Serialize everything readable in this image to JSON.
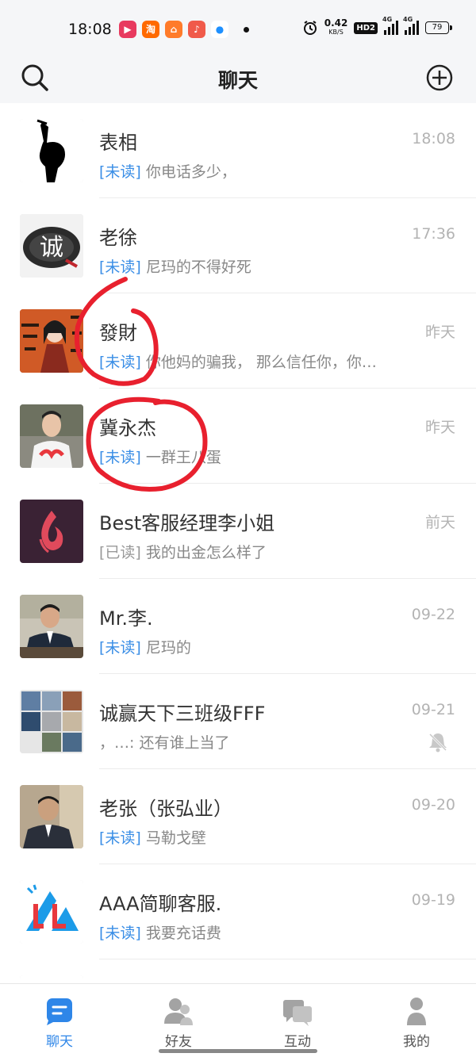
{
  "status_bar": {
    "time": "18:08",
    "app_icons": [
      {
        "icon": "video-app-icon",
        "glyph": "▶",
        "color": "#e83a5f"
      },
      {
        "icon": "taobao-app-icon",
        "glyph": "淘",
        "color": "#ff6a00"
      },
      {
        "icon": "orange-app-icon",
        "glyph": "⌂",
        "color": "#ff7b2a"
      },
      {
        "icon": "music-app-icon",
        "glyph": "♪",
        "color": "#f05a4a"
      },
      {
        "icon": "circle-app-icon",
        "glyph": "●",
        "color": "#1e90ff"
      }
    ],
    "net_speed": "0.42",
    "net_unit": "KB/S",
    "hd": "HD2",
    "signal_tag_1": "4G",
    "signal_tag_2": "4G",
    "battery": "79"
  },
  "header": {
    "title": "聊天",
    "search_icon": "search-icon",
    "add_icon": "add-circle-icon"
  },
  "chats": [
    {
      "name": "表相",
      "time": "18:08",
      "tag": "[未读]",
      "tag_type": "unread",
      "message": "你电话多少，",
      "avatar": "silhouette-avatar"
    },
    {
      "name": "老徐",
      "time": "17:36",
      "tag": "[未读]",
      "tag_type": "unread",
      "message": "尼玛的不得好死",
      "avatar": "cheng-character-avatar"
    },
    {
      "name": "發財",
      "time": "昨天",
      "tag": "[未读]",
      "tag_type": "unread",
      "message": "你他妈的骗我， 那么信任你，你…",
      "avatar": "anime-girl-avatar"
    },
    {
      "name": "冀永杰",
      "time": "昨天",
      "tag": "[未读]",
      "tag_type": "unread",
      "message": "一群王八蛋",
      "avatar": "young-man-avatar"
    },
    {
      "name": "Best客服经理李小姐",
      "time": "前天",
      "tag": "[已读]",
      "tag_type": "read",
      "message": "我的出金怎么样了",
      "avatar": "flame-logo-avatar"
    },
    {
      "name": "Mr.李.",
      "time": "09-22",
      "tag": "[未读]",
      "tag_type": "unread",
      "message": "尼玛的",
      "avatar": "suit-man-avatar"
    },
    {
      "name": "诚赢天下三班级FFF",
      "time": "09-21",
      "tag": "",
      "tag_type": "none",
      "message": "，…: 还有谁上当了",
      "avatar": "group-grid-avatar",
      "muted": true
    },
    {
      "name": "老张（张弘业）",
      "time": "09-20",
      "tag": "[未读]",
      "tag_type": "unread",
      "message": "马勒戈壁",
      "avatar": "car-man-avatar"
    },
    {
      "name": "AAA简聊客服.",
      "time": "09-19",
      "tag": "[未读]",
      "tag_type": "unread",
      "message": "我要充话费",
      "avatar": "jl-logo-avatar"
    }
  ],
  "tabs": [
    {
      "label": "聊天",
      "icon": "chat-tab-icon",
      "active": true
    },
    {
      "label": "好友",
      "icon": "friends-tab-icon",
      "active": false
    },
    {
      "label": "互动",
      "icon": "interaction-tab-icon",
      "active": false
    },
    {
      "label": "我的",
      "icon": "profile-tab-icon",
      "active": false
    }
  ],
  "colors": {
    "accent": "#2e86e8",
    "unread_tag": "#3a8ee6",
    "annotation": "#e8202e"
  }
}
